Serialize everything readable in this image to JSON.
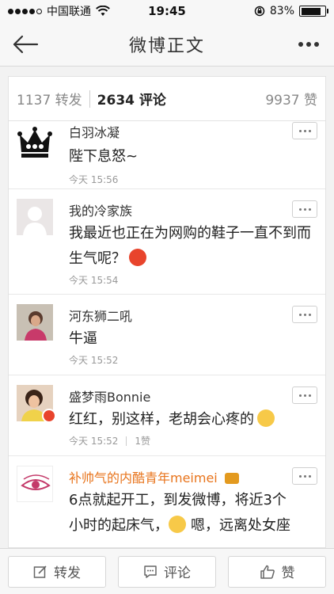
{
  "status_bar": {
    "carrier": "中国联通",
    "time": "19:45",
    "battery": "83%",
    "battery_level": 0.83
  },
  "nav": {
    "title": "微博正文"
  },
  "tabs": {
    "reposts": "1137 转发",
    "comments": "2634 评论",
    "likes": "9937 赞"
  },
  "comments": [
    {
      "name": "白羽冰凝",
      "text": "陛下息怒~",
      "time": "今天 15:56",
      "avatar": "crown-avatar"
    },
    {
      "name": "我的冷家族",
      "text": "我最近也正在为网购的鞋子一直不到而生气呢？",
      "time": "今天 15:54",
      "emoji": "angry-emoji",
      "avatar": "default-avatar"
    },
    {
      "name": "河东狮二吼",
      "text": "牛逼",
      "time": "今天 15:52",
      "avatar": "photo-avatar"
    },
    {
      "name": "盛梦雨Bonnie",
      "text": "红红，别这样，老胡会心疼的",
      "time": "今天 15:52",
      "likes": "1赞",
      "emoji": "thinking-emoji",
      "avatar": "child-photo-avatar"
    },
    {
      "name": "补帅气的内酷青年meimei",
      "text_line1": "6点就起开工，到发微博，将近3个",
      "text_line2": "小时的起床气，",
      "text_line2b": "嗯，远离处女座",
      "time": "",
      "avatar": "eye-drawing-avatar",
      "colors": {
        "vip_name": "#e8741c"
      }
    }
  ],
  "toolbar": {
    "repost": "转发",
    "comment": "评论",
    "like": "赞"
  }
}
